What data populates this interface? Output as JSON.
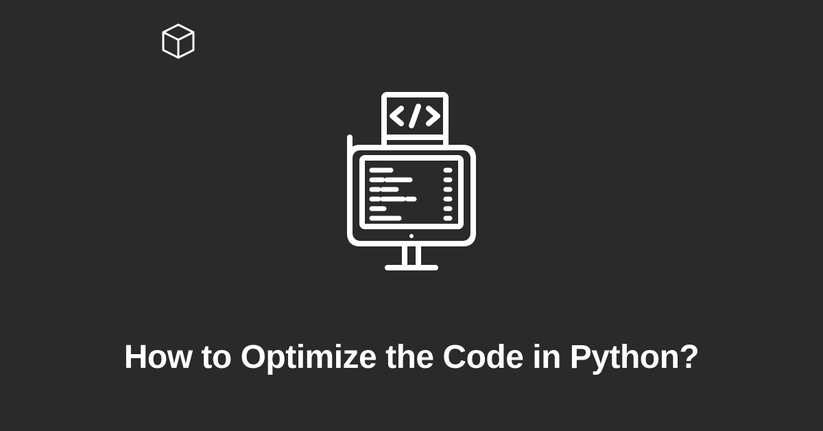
{
  "title": "How to Optimize the Code in Python?",
  "logo_name": "cube-icon",
  "illustration_name": "computer-code-icon"
}
